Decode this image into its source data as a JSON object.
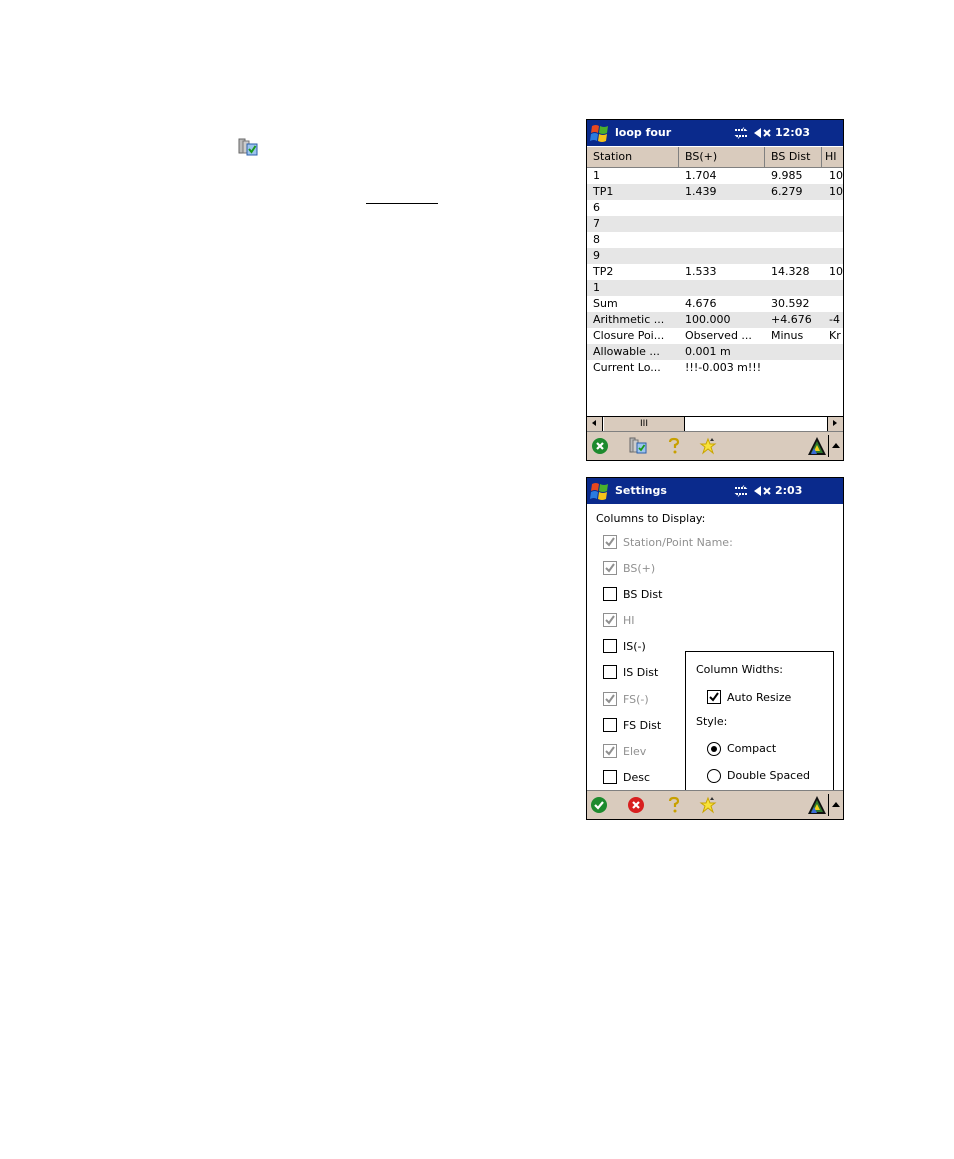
{
  "document": {
    "inline_icon": "column-settings-icon"
  },
  "screen1": {
    "title": "loop four",
    "clock": "12:03",
    "status_icons": [
      "connectivity-icon",
      "speaker-muted-icon"
    ],
    "columns": [
      "Station",
      "BS(+)",
      "BS Dist",
      "HI"
    ],
    "rows": [
      [
        "1",
        "1.704",
        "9.985",
        "10"
      ],
      [
        "TP1",
        "1.439",
        "6.279",
        "10"
      ],
      [
        "6",
        "",
        "",
        ""
      ],
      [
        "7",
        "",
        "",
        ""
      ],
      [
        "8",
        "",
        "",
        ""
      ],
      [
        "9",
        "",
        "",
        ""
      ],
      [
        "TP2",
        "1.533",
        "14.328",
        "10"
      ],
      [
        "1",
        "",
        "",
        ""
      ],
      [
        "Sum",
        "4.676",
        "30.592",
        ""
      ],
      [
        "Arithmetic ...",
        "100.000",
        "+4.676",
        "-4"
      ],
      [
        "Closure Poi...",
        "Observed ...",
        "Minus",
        "Kr"
      ],
      [
        "Allowable ...",
        "0.001 m",
        "",
        ""
      ],
      [
        "Current Lo...",
        "!!!-0.003 m!!!",
        "",
        ""
      ]
    ],
    "scroll_thumb_glyph": "III",
    "menu_icons": [
      "close-icon",
      "column-settings-icon",
      "help-icon",
      "favorites-icon"
    ],
    "sip_icon": "input-panel-icon"
  },
  "screen2": {
    "title": "Settings",
    "clock": "2:03",
    "columns_label": "Columns to Display:",
    "columns": [
      {
        "label": "Station/Point Name:",
        "checked": true,
        "disabled": true
      },
      {
        "label": "BS(+)",
        "checked": true,
        "disabled": true
      },
      {
        "label": "BS Dist",
        "checked": false,
        "disabled": false
      },
      {
        "label": "HI",
        "checked": true,
        "disabled": true
      },
      {
        "label": "IS(-)",
        "checked": false,
        "disabled": false
      },
      {
        "label": "IS Dist",
        "checked": false,
        "disabled": false
      },
      {
        "label": "FS(-)",
        "checked": true,
        "disabled": true
      },
      {
        "label": "FS Dist",
        "checked": false,
        "disabled": false
      },
      {
        "label": "Elev",
        "checked": true,
        "disabled": true
      },
      {
        "label": "Desc",
        "checked": false,
        "disabled": false
      }
    ],
    "column_widths_label": "Column Widths:",
    "auto_resize_label": "Auto Resize",
    "auto_resize_checked": true,
    "style_label": "Style:",
    "style_options": [
      "Compact",
      "Double Spaced"
    ],
    "style_selected": "Compact",
    "menu_icons": [
      "ok-icon",
      "cancel-icon",
      "help-icon",
      "favorites-icon"
    ]
  }
}
